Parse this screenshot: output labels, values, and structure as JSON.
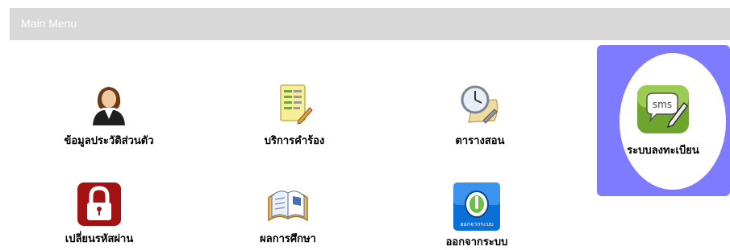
{
  "header": {
    "title": "Main Menu"
  },
  "menu": {
    "profile": {
      "label": "ข้อมูลประวัติส่วนตัว",
      "icon": "person-icon"
    },
    "request": {
      "label": "บริการคำร้อง",
      "icon": "document-pencil-icon"
    },
    "schedule": {
      "label": "ตารางสอน",
      "icon": "clock-scroll-icon"
    },
    "register": {
      "label": "ระบบลงทะเบียน",
      "icon": "sms-icon"
    },
    "password": {
      "label": "เปลี่ยนรหัสผ่าน",
      "icon": "lock-icon"
    },
    "grades": {
      "label": "ผลการศึกษา",
      "icon": "open-book-icon"
    },
    "logout": {
      "label": "ออกจากระบบ",
      "icon": "power-button-icon",
      "icon_caption": "ออกจากระบบ"
    }
  },
  "colors": {
    "highlight": "#7f7bff",
    "header": "#d8d8d8"
  }
}
